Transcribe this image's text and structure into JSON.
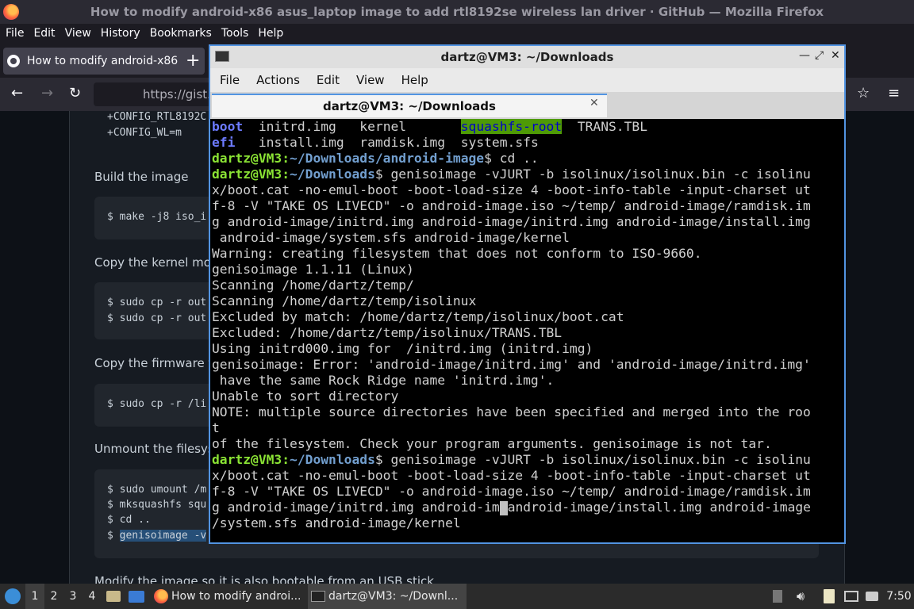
{
  "firefox": {
    "title": "How to modify android-x86 asus_laptop image to add rtl8192se wireless lan driver · GitHub — Mozilla Firefox",
    "menu": [
      "File",
      "Edit",
      "View",
      "History",
      "Bookmarks",
      "Tools",
      "Help"
    ],
    "tab_label": "How to modify android-x86",
    "new_tab": "+",
    "url": "https://gist.g"
  },
  "page": {
    "code_top": [
      "+CONFIG_RTL8192C",
      "+CONFIG_WL=m"
    ],
    "build_heading": "Build the image",
    "build_code": "$ make -j8 iso_i",
    "copy_kernel_heading": "Copy the kernel mod",
    "copy_kernel_code": [
      "$ sudo cp -r out",
      "$ sudo cp -r out"
    ],
    "copy_firmware_heading": "Copy the firmware fr",
    "copy_firmware_code": "$ sudo cp -r /li",
    "unmount_heading": "Unmount the filesyst",
    "unmount_code": [
      "$ sudo umount /m",
      "$ mksquashfs squ",
      "$ cd ..",
      "$ "
    ],
    "unmount_code_selected": "genisoimage -v",
    "usb_heading": "Modify the image so it is also bootable from an USB stick"
  },
  "terminal": {
    "title": "dartz@VM3: ~/Downloads",
    "menu": [
      "File",
      "Actions",
      "Edit",
      "View",
      "Help"
    ],
    "tab_title": "dartz@VM3: ~/Downloads",
    "close_glyph": "✕",
    "ls": {
      "r1": [
        "boot",
        "initrd.img",
        "kernel",
        "squashfs-root",
        "TRANS.TBL"
      ],
      "r2": [
        "efi",
        "install.img",
        "ramdisk.img",
        "system.sfs"
      ]
    },
    "prompt_user": "dartz@VM3",
    "prompt_sep": ":",
    "path_android": "~/Downloads/android-image",
    "path_dl": "~/Downloads",
    "prompt_end": "$ ",
    "cmd_cd": "cd ..",
    "cmd1_start": "genisoimage -vJURT -b isolinux/isolinux.bin -c isolinu",
    "cmd1_lines": [
      "x/boot.cat -no-emul-boot -boot-load-size 4 -boot-info-table -input-charset ut",
      "f-8 -V \"TAKE OS LIVECD\" -o android-image.iso ~/temp/ android-image/ramdisk.im",
      "g android-image/initrd.img android-image/initrd.img android-image/install.img",
      " android-image/system.sfs android-image/kernel"
    ],
    "output": [
      "Warning: creating filesystem that does not conform to ISO-9660.",
      "genisoimage 1.1.11 (Linux)",
      "Scanning /home/dartz/temp/",
      "Scanning /home/dartz/temp/isolinux",
      "Excluded by match: /home/dartz/temp/isolinux/boot.cat",
      "Excluded: /home/dartz/temp/isolinux/TRANS.TBL",
      "Using initrd000.img for  /initrd.img (initrd.img)",
      "genisoimage: Error: 'android-image/initrd.img' and 'android-image/initrd.img'",
      " have the same Rock Ridge name 'initrd.img'.",
      "Unable to sort directory",
      "NOTE: multiple source directories have been specified and merged into the roo",
      "t",
      "of the filesystem. Check your program arguments. genisoimage is not tar."
    ],
    "cmd2_start": "genisoimage -vJURT -b isolinux/isolinux.bin -c isolinu",
    "cmd2_lines": [
      "x/boot.cat -no-emul-boot -boot-load-size 4 -boot-info-table -input-charset ut",
      "f-8 -V \"TAKE OS LIVECD\" -o android-image.iso ~/temp/ android-image/ramdisk.im"
    ],
    "cmd2_l4_a": "g android-image/initrd.img android-im",
    "cmd2_l4_b": "android-image/install.img android-image",
    "cmd2_l5": "/system.sfs android-image/kernel"
  },
  "taskbar": {
    "workspaces": [
      "1",
      "2",
      "3",
      "4"
    ],
    "task_firefox": "How to modify androi...",
    "task_terminal": "dartz@VM3: ~/Downl...",
    "clock": "7:50"
  }
}
